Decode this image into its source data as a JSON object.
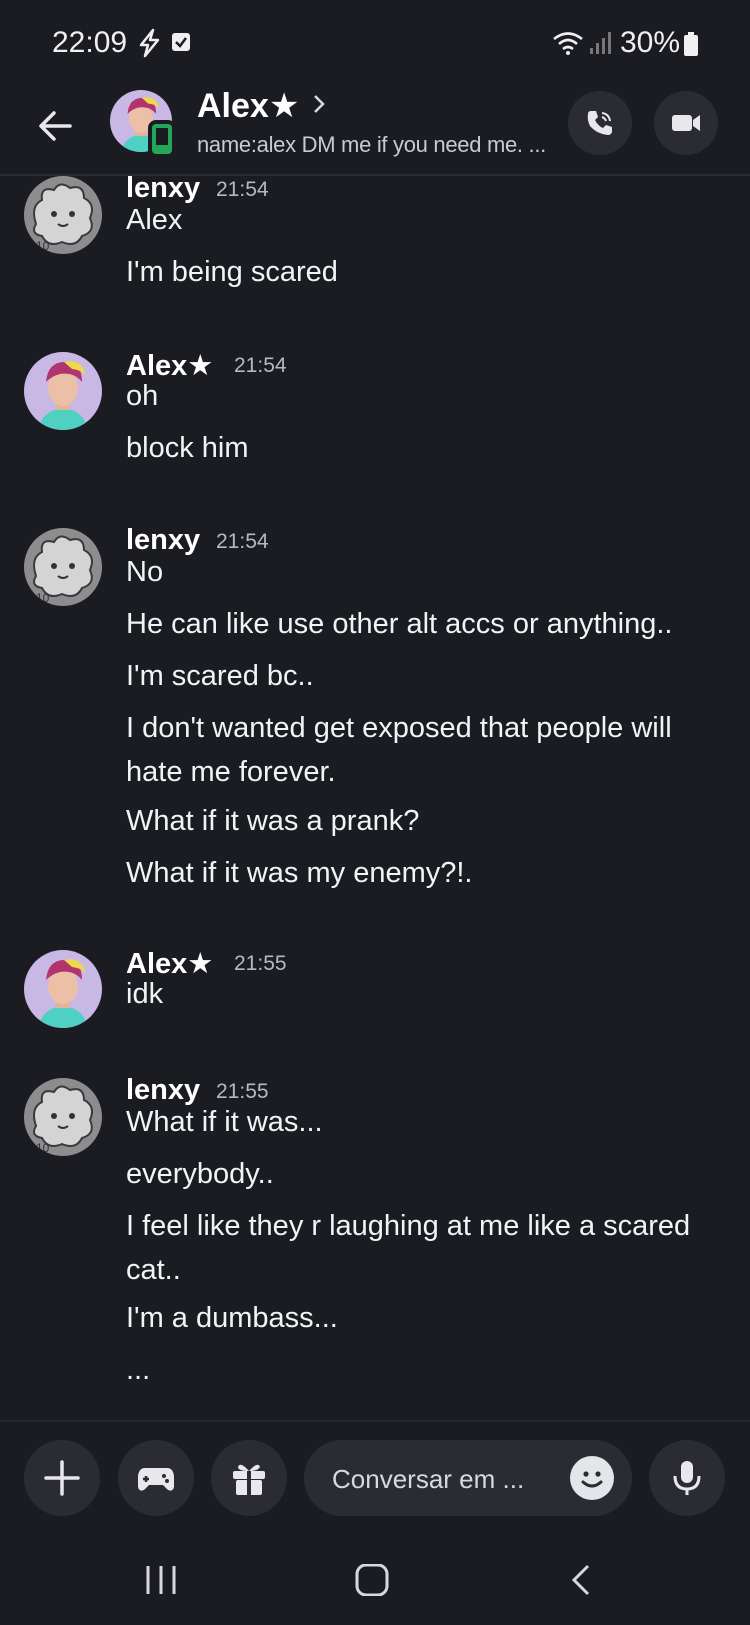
{
  "status_bar": {
    "time": "22:09",
    "battery": "30%"
  },
  "header": {
    "name": "Alex★",
    "status": "name:alex DM me if you need me. ..."
  },
  "messages": [
    {
      "author": "lenxy",
      "time": "21:54",
      "avatar": "lenxy-avatar",
      "lines": [
        "Alex",
        "I'm being scared"
      ]
    },
    {
      "author": "Alex★",
      "time": "21:54",
      "avatar": "alex-avatar",
      "lines": [
        "oh",
        "block him"
      ]
    },
    {
      "author": "lenxy",
      "time": "21:54",
      "avatar": "lenxy-avatar",
      "lines": [
        "No",
        "He can like use other alt accs or anything..",
        "I'm scared bc..",
        "I don't wanted get exposed that people will hate me forever.",
        "What if it was a prank?",
        "What if it was my enemy?!."
      ]
    },
    {
      "author": "Alex★",
      "time": "21:55",
      "avatar": "alex-avatar",
      "lines": [
        "idk"
      ]
    },
    {
      "author": "lenxy",
      "time": "21:55",
      "avatar": "lenxy-avatar",
      "lines": [
        "What if it was...",
        "everybody..",
        "I feel like they r laughing at me like a scared cat..",
        "I'm a dumbass...",
        "..."
      ]
    }
  ],
  "composer": {
    "placeholder": "Conversar em ..."
  },
  "icons": {
    "back": "arrow-left-icon",
    "call": "phone-icon",
    "video": "video-camera-icon",
    "plus": "plus-icon",
    "game": "gamepad-icon",
    "gift": "gift-icon",
    "emoji": "emoji-icon",
    "mic": "microphone-icon"
  },
  "colors": {
    "background": "#1b1c21",
    "button": "#2b2c33",
    "online_mobile": "#23a55a"
  }
}
